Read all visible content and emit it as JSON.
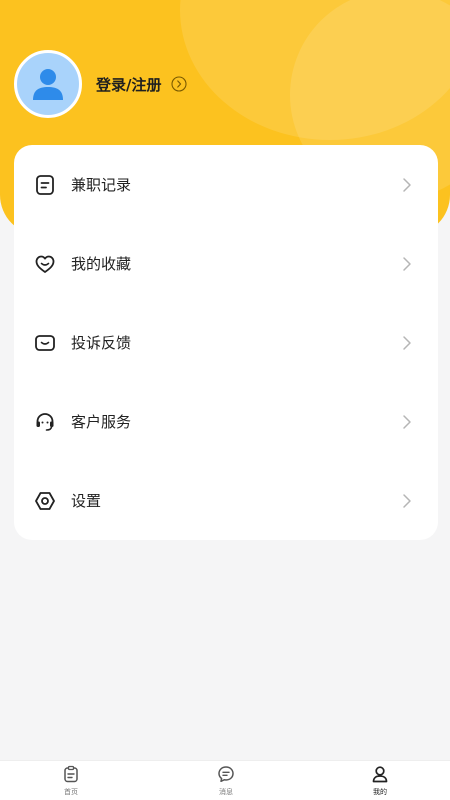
{
  "profile": {
    "login_label": "登录/注册",
    "avatar_icon": "user-avatar-icon",
    "arrow_icon": "chevron-right-circle-icon"
  },
  "menu": {
    "items": [
      {
        "label": "兼职记录",
        "icon": "document-icon"
      },
      {
        "label": "我的收藏",
        "icon": "heart-icon"
      },
      {
        "label": "投诉反馈",
        "icon": "feedback-icon"
      },
      {
        "label": "客户服务",
        "icon": "headset-icon"
      },
      {
        "label": "设置",
        "icon": "settings-hexagon-icon"
      }
    ]
  },
  "tabbar": {
    "tabs": [
      {
        "label": "首页",
        "icon": "home-clipboard-icon"
      },
      {
        "label": "消息",
        "icon": "message-icon"
      },
      {
        "label": "我的",
        "icon": "person-icon"
      }
    ],
    "active_index": 2
  },
  "colors": {
    "brand_yellow": "#fcc21f",
    "avatar_blue": "#a9d3fb",
    "page_bg": "#f5f5f6"
  }
}
